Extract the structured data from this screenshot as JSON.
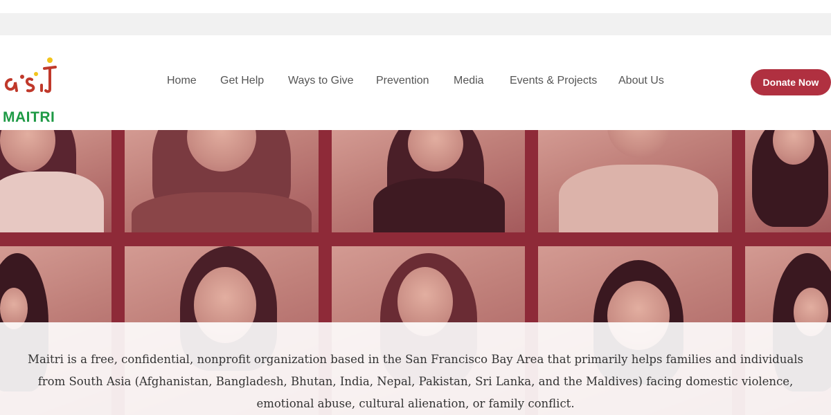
{
  "brand": {
    "logo_text": "MAITRI",
    "logo_colors": {
      "red": "#c0392b",
      "green": "#1e9a45",
      "yellow": "#f2c41c"
    }
  },
  "nav": {
    "items": [
      {
        "label": "Home"
      },
      {
        "label": "Get Help"
      },
      {
        "label": "Ways to Give"
      },
      {
        "label": "Prevention"
      },
      {
        "label": "Media"
      },
      {
        "label": "Events & Projects"
      },
      {
        "label": "About Us"
      }
    ],
    "donate_label": "Donate Now"
  },
  "hero": {
    "description": "Maitri is a free, confidential, nonprofit organization based in the San Francisco Bay Area that primarily helps families and individuals from South Asia (Afghanistan, Bangladesh, Bhutan, India, Nepal, Pakistan, Sri Lanka, and the Maldives) facing domestic violence, emotional abuse, cultural alienation, or family conflict."
  },
  "colors": {
    "accent": "#b03040",
    "overlay": "#8e2a38",
    "nav_text": "#555555"
  }
}
